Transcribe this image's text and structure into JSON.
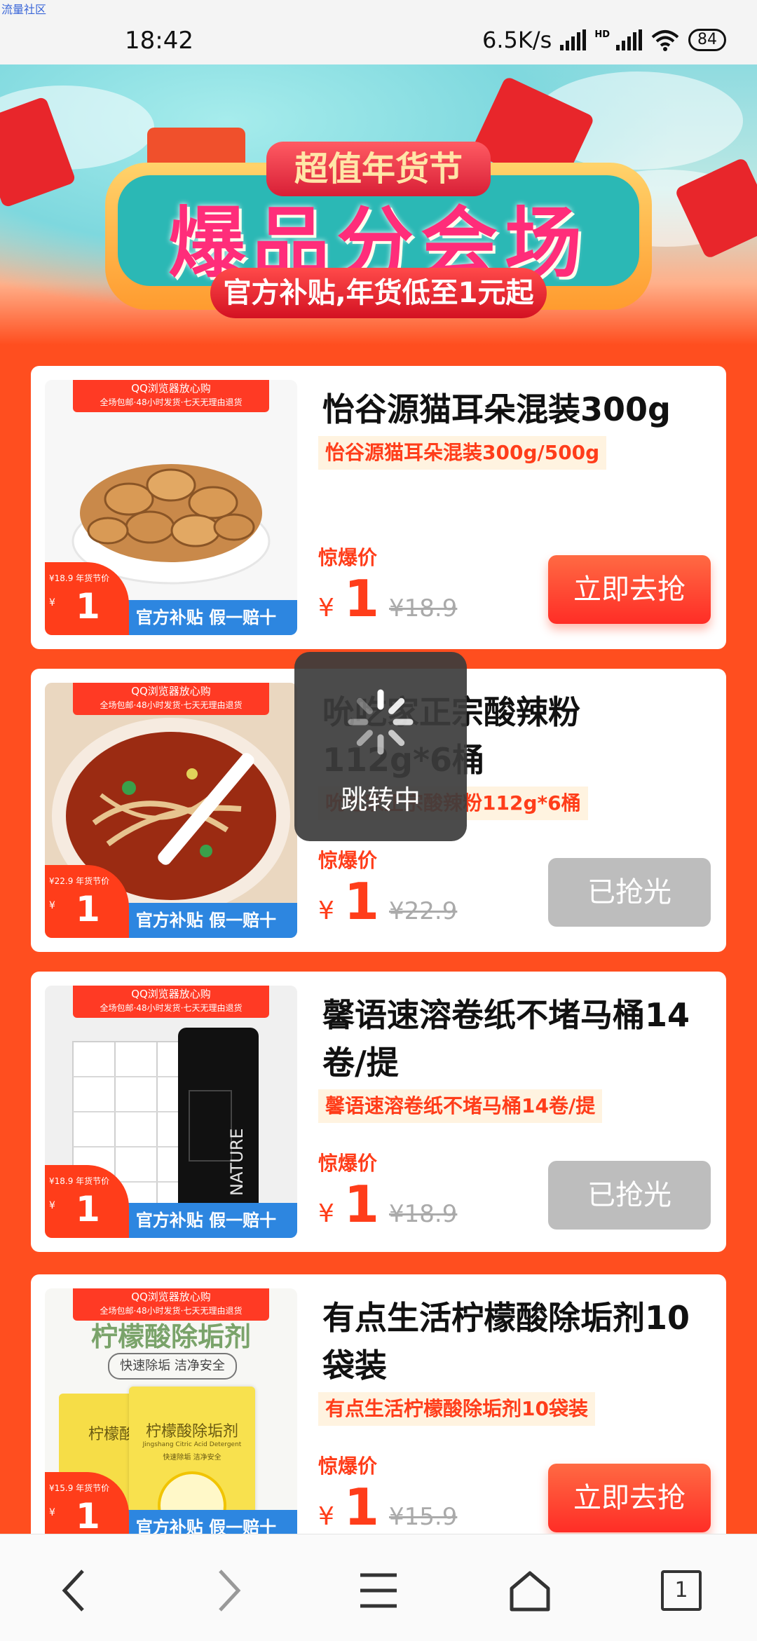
{
  "watermark": "流量社区",
  "status_bar": {
    "time": "18:42",
    "speed": "6.5K/s",
    "hd": "HD",
    "battery": "84"
  },
  "banner": {
    "ribbon": "超值年货节",
    "title": "爆品分会场",
    "subtitle": "官方补贴,年货低至1元起"
  },
  "toast": {
    "text": "跳转中"
  },
  "products": [
    {
      "title": "怡谷源猫耳朵混装300g",
      "tag": "怡谷源猫耳朵混装300g/500g",
      "price_label": "惊爆价",
      "currency": "¥",
      "price": "1",
      "original_price": "¥18.9",
      "button": "立即去抢",
      "sold_out": false,
      "thumb_banner_1": "QQ浏览器放心购",
      "thumb_banner_2": "全场包邮·48小时发货·七天无理由退货",
      "thumb_badge_label": "¥18.9 年货节价",
      "thumb_badge_currency": "¥",
      "thumb_badge_price": "1",
      "thumb_footer": "官方补贴 假一赔十"
    },
    {
      "title": "吮吃家正宗酸辣粉112g*6桶",
      "tag": "吮吃家正宗酸辣粉112g*6桶",
      "price_label": "惊爆价",
      "currency": "¥",
      "price": "1",
      "original_price": "¥22.9",
      "button": "已抢光",
      "sold_out": true,
      "thumb_banner_1": "QQ浏览器放心购",
      "thumb_banner_2": "全场包邮·48小时发货·七天无理由退货",
      "thumb_badge_label": "¥22.9 年货节价",
      "thumb_badge_currency": "¥",
      "thumb_badge_price": "1",
      "thumb_footer": "官方补贴 假一赔十"
    },
    {
      "title": "馨语速溶卷纸不堵马桶14卷/提",
      "tag": "馨语速溶卷纸不堵马桶14卷/提",
      "price_label": "惊爆价",
      "currency": "¥",
      "price": "1",
      "original_price": "¥18.9",
      "button": "已抢光",
      "sold_out": true,
      "thumb_banner_1": "QQ浏览器放心购",
      "thumb_banner_2": "全场包邮·48小时发货·七天无理由退货",
      "thumb_badge_label": "¥18.9 年货节价",
      "thumb_badge_currency": "¥",
      "thumb_badge_price": "1",
      "thumb_footer": "官方补贴 假一赔十",
      "thumb_text": "NATURE"
    },
    {
      "title": "有点生活柠檬酸除垢剂10袋装",
      "tag": "有点生活柠檬酸除垢剂10袋装",
      "price_label": "惊爆价",
      "currency": "¥",
      "price": "1",
      "original_price": "¥15.9",
      "button": "立即去抢",
      "sold_out": false,
      "thumb_banner_1": "QQ浏览器放心购",
      "thumb_banner_2": "全场包邮·48小时发货·七天无理由退货",
      "thumb_badge_label": "¥15.9 年货节价",
      "thumb_badge_currency": "¥",
      "thumb_badge_price": "1",
      "thumb_footer": "官方补贴 假一赔十",
      "thumb_heading": "柠檬酸除垢剂",
      "thumb_sub": "快速除垢 洁净安全",
      "thumb_pack_1": "柠檬酸",
      "thumb_pack_2": "柠檬酸除垢剂",
      "thumb_pack_en": "Jingshang Citric Acid Detergent",
      "thumb_pack_sub": "快速除垢 洁净安全"
    }
  ],
  "nav": {
    "tab_count": "1"
  },
  "colors": {
    "page_bg": "#ff4e1f",
    "accent": "#ff3d1a",
    "sold_out": "#bdbdbd"
  }
}
